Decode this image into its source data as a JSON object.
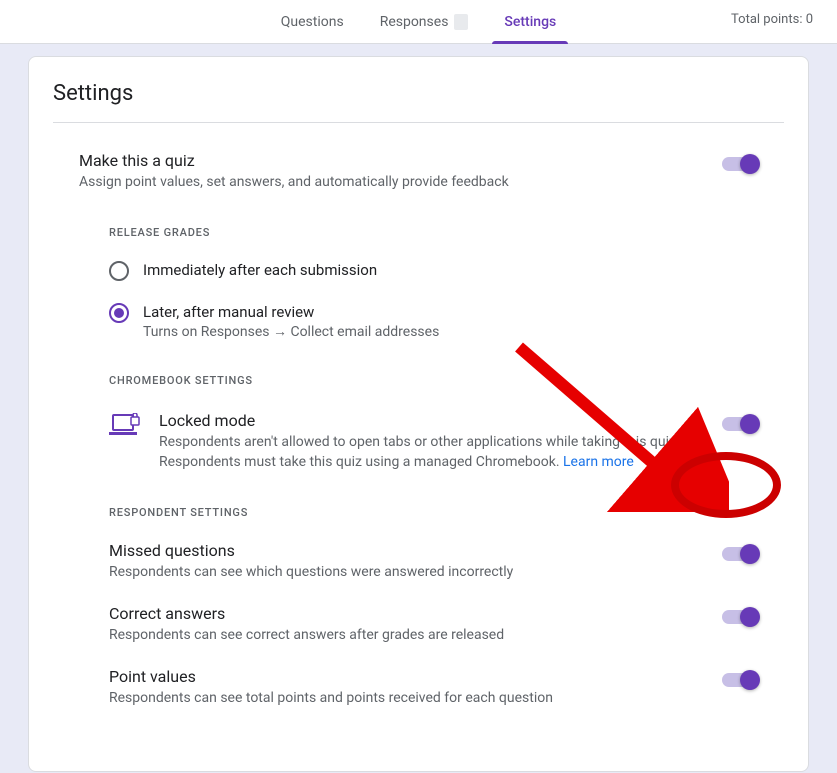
{
  "topbar": {
    "tabs": {
      "questions": "Questions",
      "responses": "Responses",
      "settings": "Settings"
    },
    "total_points_label": "Total points: 0"
  },
  "settings": {
    "title": "Settings",
    "quiz": {
      "title": "Make this a quiz",
      "desc": "Assign point values, set answers, and automatically provide feedback"
    },
    "release_grades": {
      "label": "RELEASE GRADES",
      "immediate": "Immediately after each submission",
      "later": "Later, after manual review",
      "later_sub": "Turns on Responses → Collect email addresses"
    },
    "chromebook": {
      "label": "CHROMEBOOK SETTINGS",
      "locked_title": "Locked mode",
      "locked_desc": "Respondents aren't allowed to open tabs or other applications while taking this quiz. Respondents must take this quiz using a managed Chromebook. ",
      "learn_more": "Learn more"
    },
    "respondent": {
      "label": "RESPONDENT SETTINGS",
      "missed_title": "Missed questions",
      "missed_desc": "Respondents can see which questions were answered incorrectly",
      "correct_title": "Correct answers",
      "correct_desc": "Respondents can see correct answers after grades are released",
      "points_title": "Point values",
      "points_desc": "Respondents can see total points and points received for each question"
    }
  }
}
